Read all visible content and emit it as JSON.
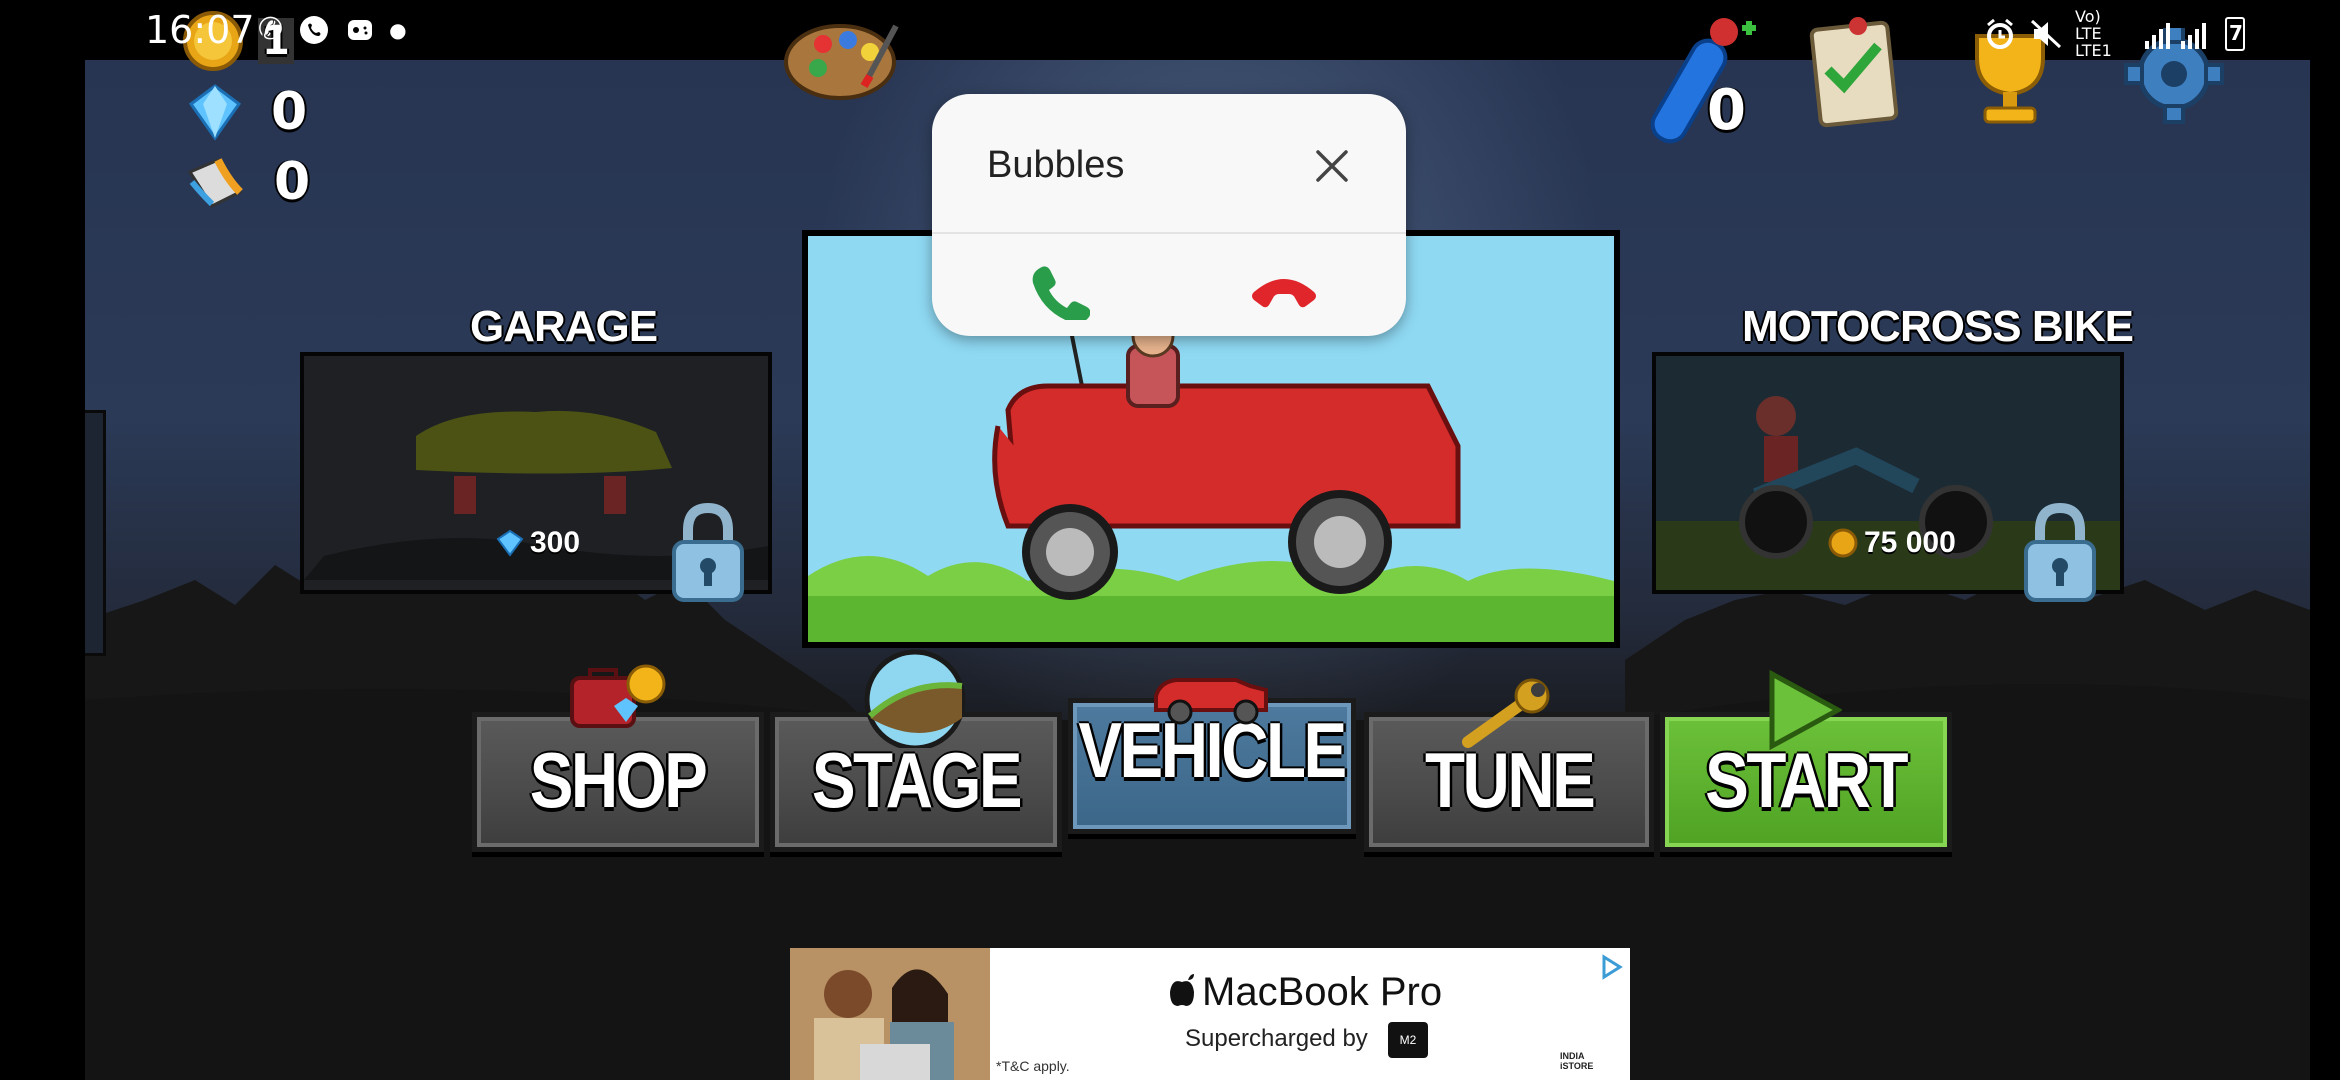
{
  "status_bar": {
    "time": "16:07",
    "signal_text": "Vo) LTE LTE1",
    "battery_level": "7"
  },
  "currencies": {
    "coins": "1",
    "gems": "0",
    "paint": "0"
  },
  "fuel_count": "0",
  "panels": {
    "left": {
      "title": "GARAGE",
      "price": "300",
      "currency_icon": "gem-icon",
      "locked": true
    },
    "right": {
      "title": "MOTOCROSS BIKE",
      "price": "75 000",
      "currency_icon": "coin-icon",
      "locked": true
    },
    "center": {
      "vehicle": "hill-climber-jeep"
    }
  },
  "menu": {
    "shop": "SHOP",
    "stage": "STAGE",
    "vehicle": "VEHICLE",
    "tune": "TUNE",
    "start": "START"
  },
  "call_popup": {
    "caller": "Bubbles",
    "accept_icon": "phone-accept-icon",
    "decline_icon": "phone-decline-icon"
  },
  "ad": {
    "brand": "MacBook Pro",
    "tagline": "Supercharged by",
    "chip": "M2",
    "disclaimer": "*T&C apply.",
    "store_line1": "INDIA",
    "store_line2": "iSTORE"
  },
  "colors": {
    "start_green": "#5bb02c",
    "vehicle_blue": "#3f6b8f",
    "button_gray": "#4a4a4a",
    "accept_green": "#2a9d4a",
    "decline_red": "#e0262b"
  }
}
